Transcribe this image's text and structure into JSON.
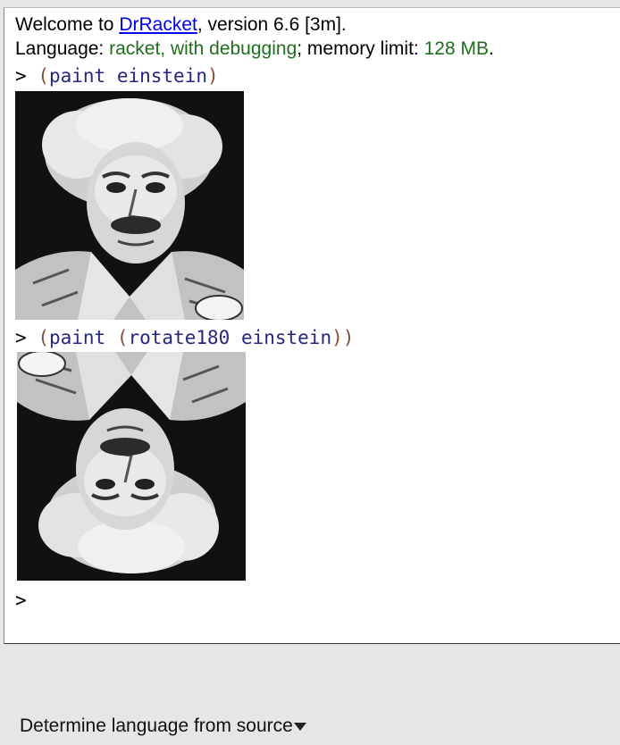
{
  "interactions": {
    "welcome": {
      "prefix": "Welcome to ",
      "link": "DrRacket",
      "suffix": ", version 6.6 [3m]."
    },
    "language": {
      "label": "Language: ",
      "name": "racket, with debugging",
      "sep": "; memory limit: ",
      "limit": "128 MB",
      "end": "."
    },
    "entries": [
      {
        "prompt": ">",
        "open": "(",
        "fn": "paint",
        "arg": "einstein",
        "close": ")",
        "result_image": "einstein-portrait"
      },
      {
        "prompt": ">",
        "open1": "(",
        "fn": "paint",
        "open2": "(",
        "inner_fn": "rotate180",
        "arg": "einstein",
        "close": "))",
        "result_image": "einstein-portrait-rotated-180"
      }
    ],
    "empty_prompt": ">"
  },
  "bottom_bar": {
    "language_selector": "Determine language from source",
    "dropdown_icon": "triangle-down-icon"
  },
  "colors": {
    "link": "#0000ee",
    "language_green": "#1f6e1f",
    "paren": "#8a4a3a",
    "symbol": "#262680"
  }
}
